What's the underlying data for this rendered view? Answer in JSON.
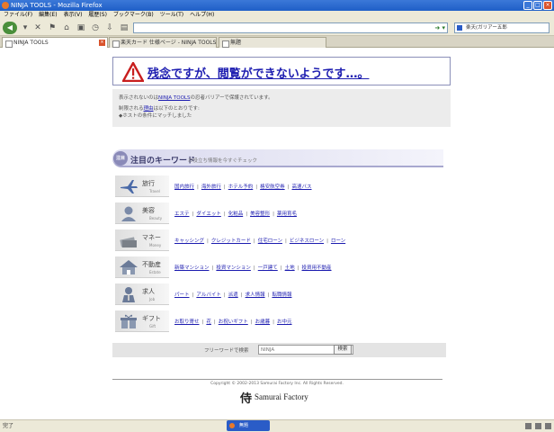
{
  "browser": {
    "title": "NINJA TOOLS - Mozilla Firefox",
    "menu": [
      "ファイル(F)",
      "編集(E)",
      "表示(V)",
      "履歴(S)",
      "ブックマーク(B)",
      "ツール(T)",
      "ヘルプ(H)"
    ],
    "search_engine": "楽天(ガリアー五郎",
    "tabs": [
      "NINJA TOOLS",
      "楽天カード 仕様ページ - NINJA TOOLS",
      "無題"
    ],
    "status": "完了",
    "taskbar_item": "無題"
  },
  "alert": {
    "title": "残念ですが、閲覧ができないようです…。"
  },
  "block_info": {
    "line1_prefix": "表示されないのは",
    "line1_link": "NINJA TOOLS",
    "line1_suffix": "の忍者バリアーで保護されています。",
    "line2_prefix": "制限される",
    "line2_link": "理由",
    "line2_suffix": "は以下のとおりです:",
    "line3": "◆ホストの条件にマッチしました"
  },
  "keywords": {
    "icon_label": "注目",
    "title": "注目のキーワード",
    "subtitle": "お役立ち情報を今すぐチェック",
    "categories": [
      {
        "name": "旅行",
        "en": "Travel",
        "icon": "airplane-icon",
        "links": [
          "国内旅行",
          "海外旅行",
          "ホテル予約",
          "格安航空券",
          "高速バス"
        ]
      },
      {
        "name": "美容",
        "en": "Beauty",
        "icon": "person-icon",
        "links": [
          "エステ",
          "ダイエット",
          "化粧品",
          "美容整形",
          "薬用育毛"
        ]
      },
      {
        "name": "マネー",
        "en": "Money",
        "icon": "money-icon",
        "links": [
          "キャッシング",
          "クレジットカード",
          "住宅ローン",
          "ビジネスローン",
          "ローン"
        ]
      },
      {
        "name": "不動産",
        "en": "Estate",
        "icon": "house-icon",
        "links": [
          "新築マンション",
          "投資マンション",
          "一戸建て",
          "土地",
          "投資用不動産"
        ]
      },
      {
        "name": "求人",
        "en": "Job",
        "icon": "job-person-icon",
        "links": [
          "パート",
          "アルバイト",
          "派遣",
          "求人情報",
          "転職情報"
        ]
      },
      {
        "name": "ギフト",
        "en": "Gift",
        "icon": "gift-icon",
        "links": [
          "お取り寄せ",
          "花",
          "お祝いギフト",
          "お歳暮",
          "お中元"
        ]
      }
    ]
  },
  "search": {
    "label": "フリーワードで検索",
    "placeholder": "NINJA",
    "button": "検索"
  },
  "footer": {
    "copyright": "Copyright © 2002-2013 Samurai Factory Inc. All Rights Reserved.",
    "logo_kanji": "侍",
    "brand": "Samurai Factory"
  },
  "colors": {
    "link": "#1d1db0",
    "alert_border": "#8b8fb8",
    "warning": "#c81e1e"
  }
}
